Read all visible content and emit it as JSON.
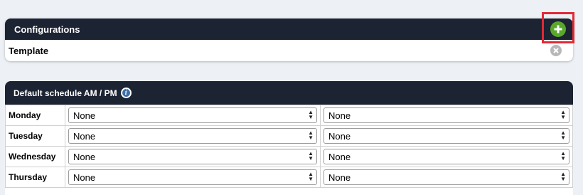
{
  "configurations": {
    "title": "Configurations",
    "add_icon": "plus-circle-icon",
    "items": [
      {
        "label": "Template",
        "remove_icon": "remove-x-icon"
      }
    ]
  },
  "schedule": {
    "title": "Default schedule AM / PM",
    "info_icon": "info-icon",
    "days": [
      {
        "day": "Monday",
        "am": "None",
        "pm": "None"
      },
      {
        "day": "Tuesday",
        "am": "None",
        "pm": "None"
      },
      {
        "day": "Wednesday",
        "am": "None",
        "pm": "None"
      },
      {
        "day": "Thursday",
        "am": "None",
        "pm": "None"
      }
    ]
  },
  "colors": {
    "header": "#1c2333",
    "add": "#5aa82a",
    "highlight": "#e02a36",
    "info": "#3d6fa8"
  }
}
